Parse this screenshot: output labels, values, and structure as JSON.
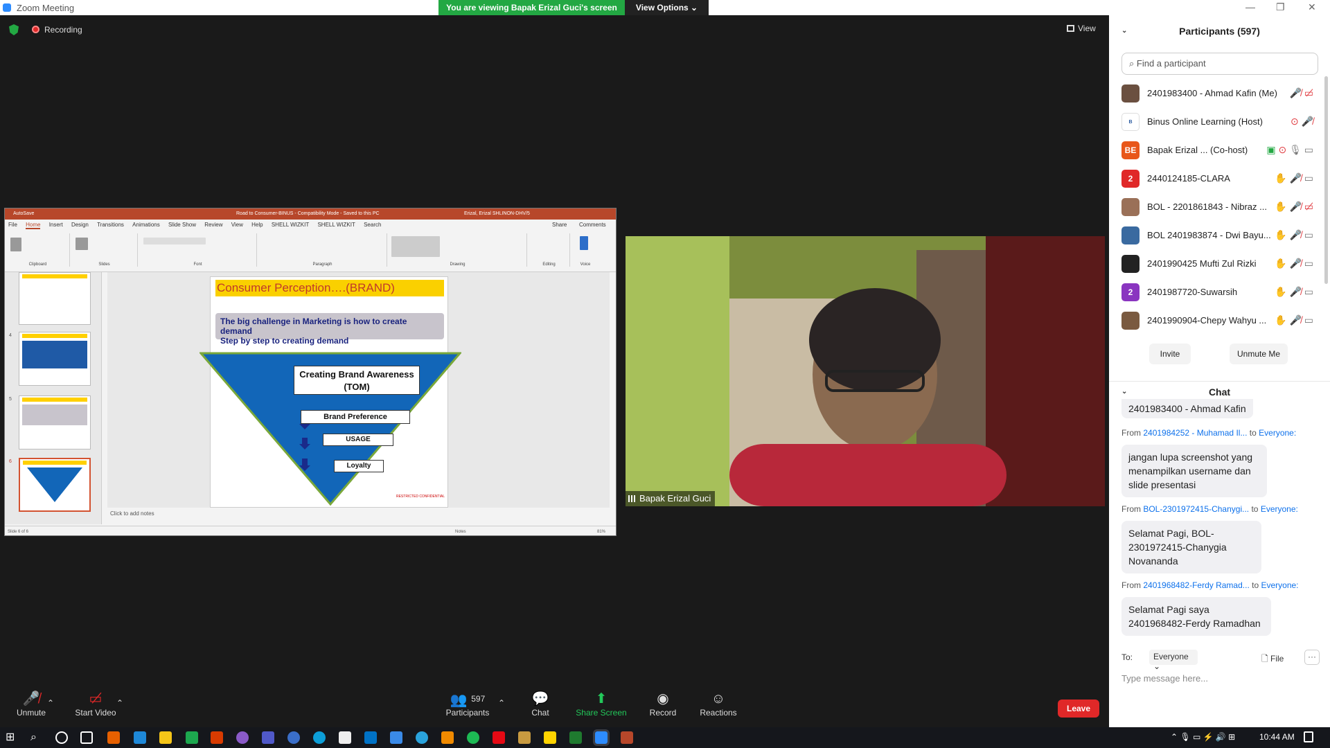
{
  "window": {
    "title": "Zoom Meeting",
    "banner": "You are viewing Bapak Erizal Guci's screen",
    "view_options": "View Options ⌄"
  },
  "meeting": {
    "recording_label": "Recording",
    "view_label": "View"
  },
  "ppt": {
    "title": "Road to Consumer-BINUS - Compatibility Mode - Saved to this PC",
    "autosave": "AutoSave",
    "user": "Erizal, Erizal SHLINON-DHV/5",
    "tabs": [
      "File",
      "Home",
      "Insert",
      "Design",
      "Transitions",
      "Animations",
      "Slide Show",
      "Review",
      "View",
      "Help",
      "SHELL WIZKIT",
      "SHELL WIZKIT",
      "Search"
    ],
    "share": "Share",
    "comments": "Comments",
    "ribbon_groups": [
      "Clipboard",
      "Slides",
      "Font",
      "Paragraph",
      "Drawing",
      "Editing",
      "Voice"
    ],
    "thumb_numbers": [
      "4",
      "5",
      "6"
    ],
    "slide_title": "Consumer Perception….(BRAND)",
    "challenge_line1": "The big challenge in Marketing is how to create demand",
    "challenge_line2": "Step by step to creating demand",
    "funnel": [
      "Creating Brand Awareness",
      "(TOM)",
      "Brand Preference",
      "USAGE",
      "Loyalty"
    ],
    "confidential": "RESTRICTED CONFIDENTIAL",
    "notes": "Click to add notes",
    "status": "Slide 6 of 6",
    "notes_btn": "Notes",
    "zoom": "81%"
  },
  "video": {
    "name": "Bapak Erizal Guci"
  },
  "participants": {
    "header": "Participants (597)",
    "search_placeholder": "Find a participant",
    "list": [
      {
        "name": "2401983400 - Ahmad Kafin (Me)",
        "avatar": "photo",
        "color": "#6b5040"
      },
      {
        "name": "Binus Online Learning (Host)",
        "avatar": "logo",
        "color": "#2a5aa0"
      },
      {
        "name": "Bapak Erizal ...  (Co-host)",
        "avatar": "BE",
        "color": "#e8571a"
      },
      {
        "name": "2440124185-CLARA",
        "avatar": "2",
        "color": "#e02828"
      },
      {
        "name": "BOL - 2201861843 - Nibraz ...",
        "avatar": "photo",
        "color": "#9a7058"
      },
      {
        "name": "BOL 2401983874 - Dwi Bayu...",
        "avatar": "photo",
        "color": "#3a6aa0"
      },
      {
        "name": "2401990425 Mufti Zul Rizki",
        "avatar": "photo",
        "color": "#222"
      },
      {
        "name": "2401987720-Suwarsih",
        "avatar": "2",
        "color": "#8a35c0"
      },
      {
        "name": "2401990904-Chepy Wahyu ...",
        "avatar": "photo",
        "color": "#7a5a40"
      }
    ],
    "invite": "Invite",
    "unmute_me": "Unmute Me"
  },
  "chat": {
    "header": "Chat",
    "top_msg": "2401983400 - Ahmad Kafin",
    "messages": [
      {
        "from_label": "From",
        "from": "2401984252 - Muhamad Il...",
        "to_label": "to",
        "to": "Everyone:",
        "text": "jangan lupa screenshot yang menampilkan username dan slide presentasi"
      },
      {
        "from_label": "From",
        "from": "BOL-2301972415-Chanygi...",
        "to_label": "to",
        "to": "Everyone:",
        "text": "Selamat Pagi, BOL-2301972415-Chanygia Novananda"
      },
      {
        "from_label": "From",
        "from": "2401968482-Ferdy Ramad...",
        "to_label": "to",
        "to": "Everyone:",
        "text": "Selamat Pagi saya 2401968482-Ferdy Ramadhan"
      }
    ],
    "to_label": "To:",
    "to_value": "Everyone ⌄",
    "file": "File",
    "more": "···",
    "placeholder": "Type message here..."
  },
  "toolbar": {
    "unmute": "Unmute",
    "start_video": "Start Video",
    "participants": "Participants",
    "participant_count": "597",
    "chat": "Chat",
    "share_screen": "Share Screen",
    "record": "Record",
    "reactions": "Reactions",
    "leave": "Leave"
  },
  "taskbar": {
    "time": "10:44 AM"
  }
}
